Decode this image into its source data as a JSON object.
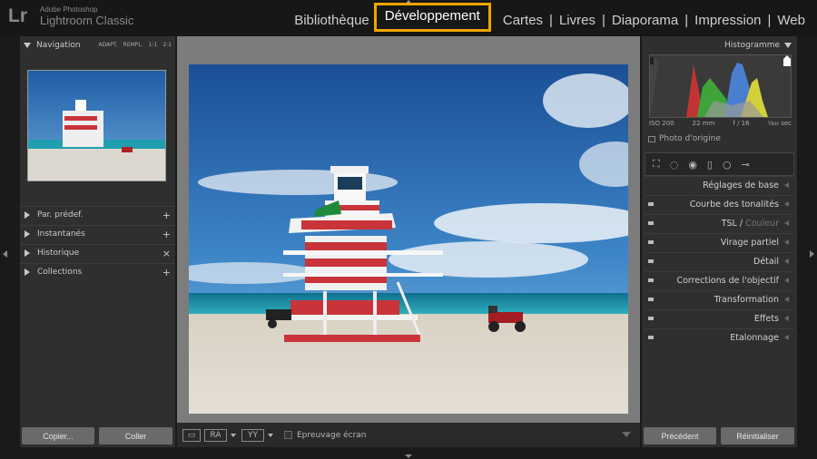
{
  "app": {
    "logo": "Lr",
    "brand_line1": "Adobe Photoshop",
    "brand_line2": "Lightroom Classic"
  },
  "modules": [
    {
      "label": "Bibliothèque",
      "active": false
    },
    {
      "label": "Développement",
      "active": true
    },
    {
      "label": "Cartes",
      "active": false
    },
    {
      "label": "Livres",
      "active": false
    },
    {
      "label": "Diaporama",
      "active": false
    },
    {
      "label": "Impression",
      "active": false
    },
    {
      "label": "Web",
      "active": false
    }
  ],
  "left_panel": {
    "navigator_title": "Navigation",
    "zoom_options": [
      "ADAPT.",
      "REMPL.",
      "1:1",
      "2:1"
    ],
    "sections": [
      {
        "label": "Par. prédef.",
        "action": "+"
      },
      {
        "label": "Instantanés",
        "action": "+"
      },
      {
        "label": "Historique",
        "action": "×"
      },
      {
        "label": "Collections",
        "action": "+"
      }
    ],
    "copy_button": "Copier...",
    "paste_button": "Coller"
  },
  "toolbar": {
    "loupe_icon": "loupe-view-icon",
    "before_after_ra": "RA",
    "before_after_yy": "YY",
    "softproof_label": "Epreuvage écran"
  },
  "right_panel": {
    "histogram_title": "Histogramme",
    "exif": {
      "iso": "ISO 200",
      "focal": "22 mm",
      "aperture": "f / 16",
      "shutter": "¹⁄₄₀₀ sec"
    },
    "original_photo": "Photo d'origine",
    "sections": [
      {
        "label": "Réglages de base"
      },
      {
        "label": "Courbe des tonalités"
      },
      {
        "label": "TSL /",
        "label_secondary": "Couleur"
      },
      {
        "label": "Virage partiel"
      },
      {
        "label": "Détail"
      },
      {
        "label": "Corrections de l'objectif"
      },
      {
        "label": "Transformation"
      },
      {
        "label": "Effets"
      },
      {
        "label": "Etalonnage"
      }
    ],
    "previous_button": "Précédent",
    "reset_button": "Réinitialiser"
  },
  "colors": {
    "active_module_border": "#f0a500",
    "panel_bg": "#2f2f2f",
    "center_bg": "#7c7c7c"
  }
}
